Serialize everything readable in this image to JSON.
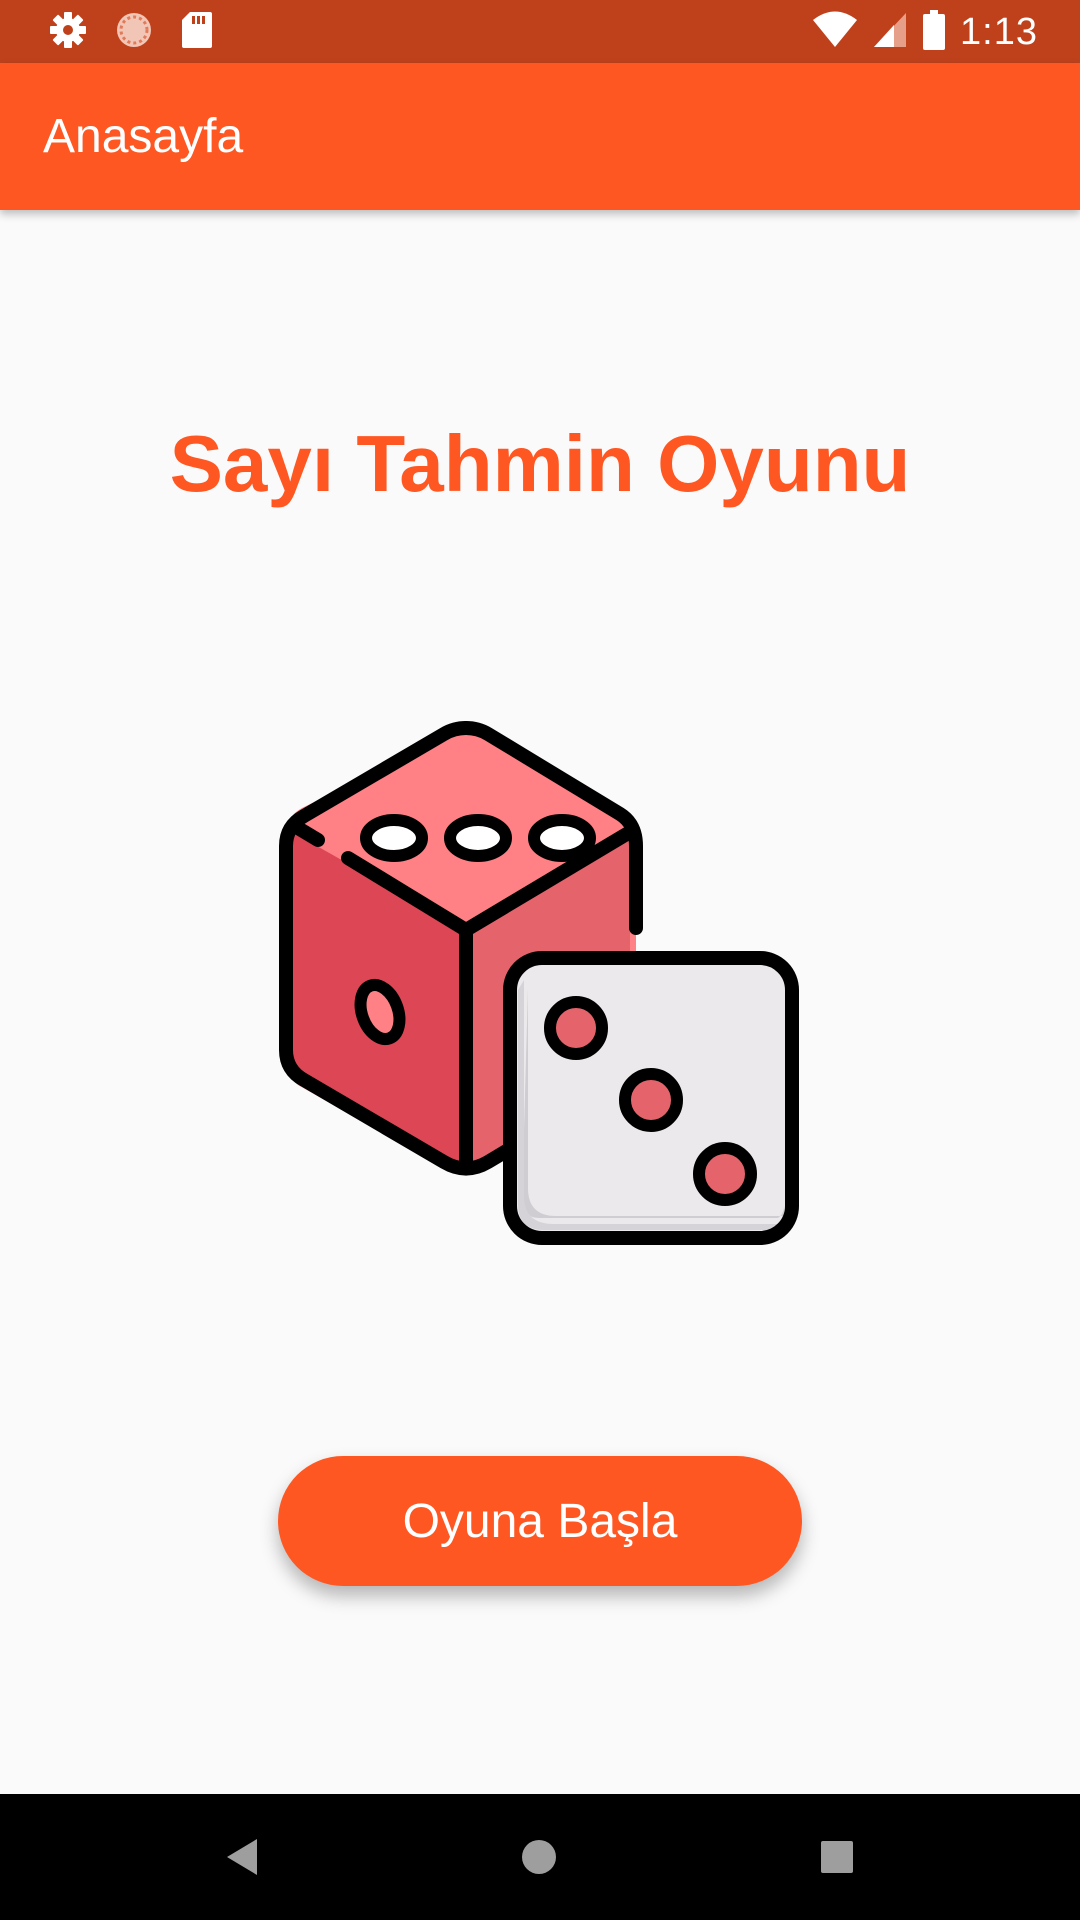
{
  "status_bar": {
    "time": "1:13",
    "left_icons": [
      "gear-icon",
      "sync-icon",
      "sd-card-icon"
    ],
    "right_icons": [
      "wifi-icon",
      "cell-signal-icon",
      "battery-icon"
    ],
    "background": "#BF411C"
  },
  "app_bar": {
    "title": "Anasayfa",
    "background": "#FF5722"
  },
  "main": {
    "heading": "Sayı Tahmin Oyunu",
    "image": "dice-icon",
    "start_button_label": "Oyuna Başla",
    "accent_color": "#FF5722"
  },
  "nav_bar": {
    "buttons": [
      "back-icon",
      "home-icon",
      "recents-icon"
    ]
  }
}
